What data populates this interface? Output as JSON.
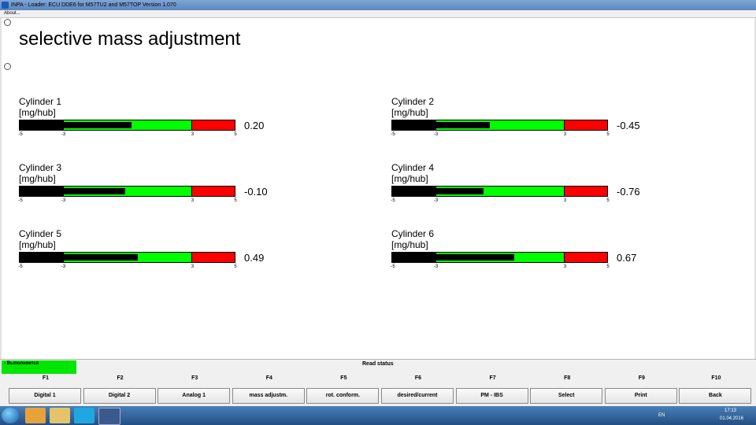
{
  "window": {
    "title": "INPA - Loader:  ECU DDE6 for M57TU2 and M57TOP Version 1.070"
  },
  "menu": {
    "about": "About..."
  },
  "page": {
    "title": "selective mass adjustment"
  },
  "scale": {
    "min_label": "-5",
    "low_label": "-3",
    "high_label": "3",
    "max_label": "5",
    "min": -5,
    "max": 5,
    "low": -3,
    "high": 3
  },
  "colors": {
    "ok": "#00ff00",
    "warn": "#ff0000",
    "fill": "#000000"
  },
  "cylinders": [
    {
      "name": "Cylinder 1",
      "unit": "[mg/hub]",
      "value": 0.2,
      "value_text": "0.20"
    },
    {
      "name": "Cylinder 2",
      "unit": "[mg/hub]",
      "value": -0.45,
      "value_text": "-0.45"
    },
    {
      "name": "Cylinder 3",
      "unit": "[mg/hub]",
      "value": -0.1,
      "value_text": "-0.10"
    },
    {
      "name": "Cylinder 4",
      "unit": "[mg/hub]",
      "value": -0.76,
      "value_text": "-0.76"
    },
    {
      "name": "Cylinder 5",
      "unit": "[mg/hub]",
      "value": 0.49,
      "value_text": "0.49"
    },
    {
      "name": "Cylinder 6",
      "unit": "[mg/hub]",
      "value": 0.67,
      "value_text": "0.67"
    }
  ],
  "status": {
    "left_text": "- Выполняется",
    "read_status": "Read status"
  },
  "fkeys": [
    {
      "key": "F1",
      "label": "Digital 1"
    },
    {
      "key": "F2",
      "label": "Digital 2"
    },
    {
      "key": "F3",
      "label": "Analog 1"
    },
    {
      "key": "F4",
      "label": "mass adjustm."
    },
    {
      "key": "F5",
      "label": "rot. conform."
    },
    {
      "key": "F6",
      "label": "desired/current"
    },
    {
      "key": "F7",
      "label": "PM - IBS"
    },
    {
      "key": "F8",
      "label": "Select"
    },
    {
      "key": "F9",
      "label": "Print"
    },
    {
      "key": "F10",
      "label": "Back"
    }
  ],
  "taskbar": {
    "lang": "EN",
    "time": "17:13",
    "date": "01.04.2016"
  }
}
